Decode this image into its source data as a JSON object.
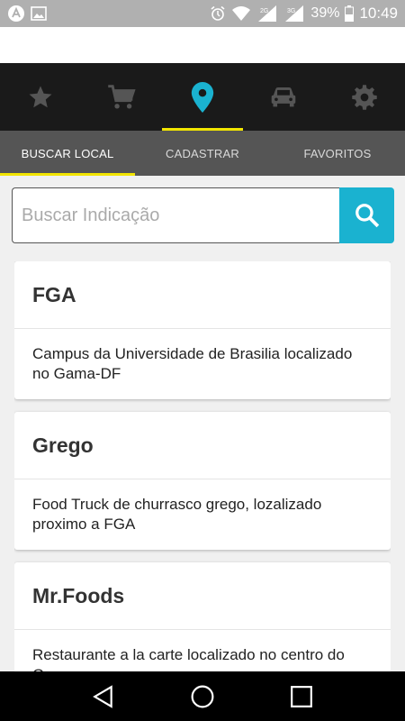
{
  "status_bar": {
    "battery_percent": "39%",
    "time": "10:49",
    "signal_labels": [
      "2G",
      "3G"
    ],
    "icons": [
      "app-icon",
      "image-icon",
      "alarm-icon",
      "wifi-icon",
      "signal-icon",
      "signal-icon-2",
      "battery-icon"
    ]
  },
  "nav_icons": [
    {
      "name": "star-icon",
      "active": false
    },
    {
      "name": "cart-icon",
      "active": false
    },
    {
      "name": "location-pin-icon",
      "active": true
    },
    {
      "name": "car-icon",
      "active": false
    },
    {
      "name": "gear-icon",
      "active": false
    }
  ],
  "tabs": [
    {
      "label": "BUSCAR LOCAL",
      "active": true
    },
    {
      "label": "CADASTRAR",
      "active": false
    },
    {
      "label": "FAVORITOS",
      "active": false
    }
  ],
  "search": {
    "placeholder": "Buscar Indicação",
    "value": ""
  },
  "cards": [
    {
      "title": "FGA",
      "description": "Campus da Universidade de Brasilia localizado no Gama-DF"
    },
    {
      "title": "Grego",
      "description": "Food Truck de churrasco grego, lozalizado proximo a FGA"
    },
    {
      "title": "Mr.Foods",
      "description": "Restaurante a la carte localizado no centro do Gama"
    }
  ],
  "colors": {
    "accent_yellow": "#f2e500",
    "accent_cyan": "#1ab2d0",
    "nav_bg": "#1a1a1a",
    "tabs_bg": "#555555"
  },
  "system_nav": [
    "back-icon",
    "home-icon",
    "recents-icon"
  ]
}
